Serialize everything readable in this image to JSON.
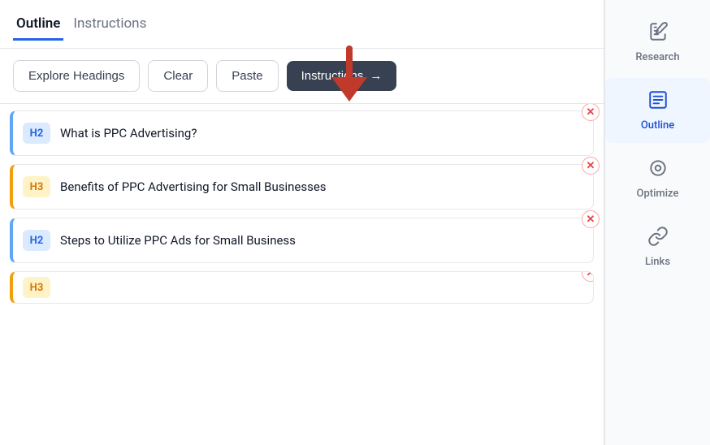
{
  "tabs": {
    "outline": {
      "label": "Outline",
      "active": true
    },
    "instructions": {
      "label": "Instructions",
      "active": false
    }
  },
  "toolbar": {
    "explore_headings": "Explore Headings",
    "clear": "Clear",
    "paste": "Paste",
    "instructions_btn": "Instructions",
    "arrow_icon": "→"
  },
  "outline_items": [
    {
      "id": 1,
      "level": "H2",
      "badge_class": "badge-h2",
      "border_class": "h2-item",
      "text": "What is PPC Advertising?"
    },
    {
      "id": 2,
      "level": "H3",
      "badge_class": "badge-h3",
      "border_class": "h3-item",
      "text": "Benefits of PPC Advertising for Small Businesses"
    },
    {
      "id": 3,
      "level": "H2",
      "badge_class": "badge-h2",
      "border_class": "h2-item",
      "text": "Steps to Utilize PPC Ads for Small Business"
    },
    {
      "id": 4,
      "level": "H3",
      "badge_class": "badge-h3",
      "border_class": "h3-item",
      "text": ""
    }
  ],
  "sidebar": {
    "items": [
      {
        "id": "research",
        "label": "Research",
        "icon": "🔭",
        "active": false
      },
      {
        "id": "outline",
        "label": "Outline",
        "icon": "📄",
        "active": true
      },
      {
        "id": "optimize",
        "label": "Optimize",
        "icon": "⊙",
        "active": false
      },
      {
        "id": "links",
        "label": "Links",
        "icon": "🔗",
        "active": false
      }
    ]
  }
}
